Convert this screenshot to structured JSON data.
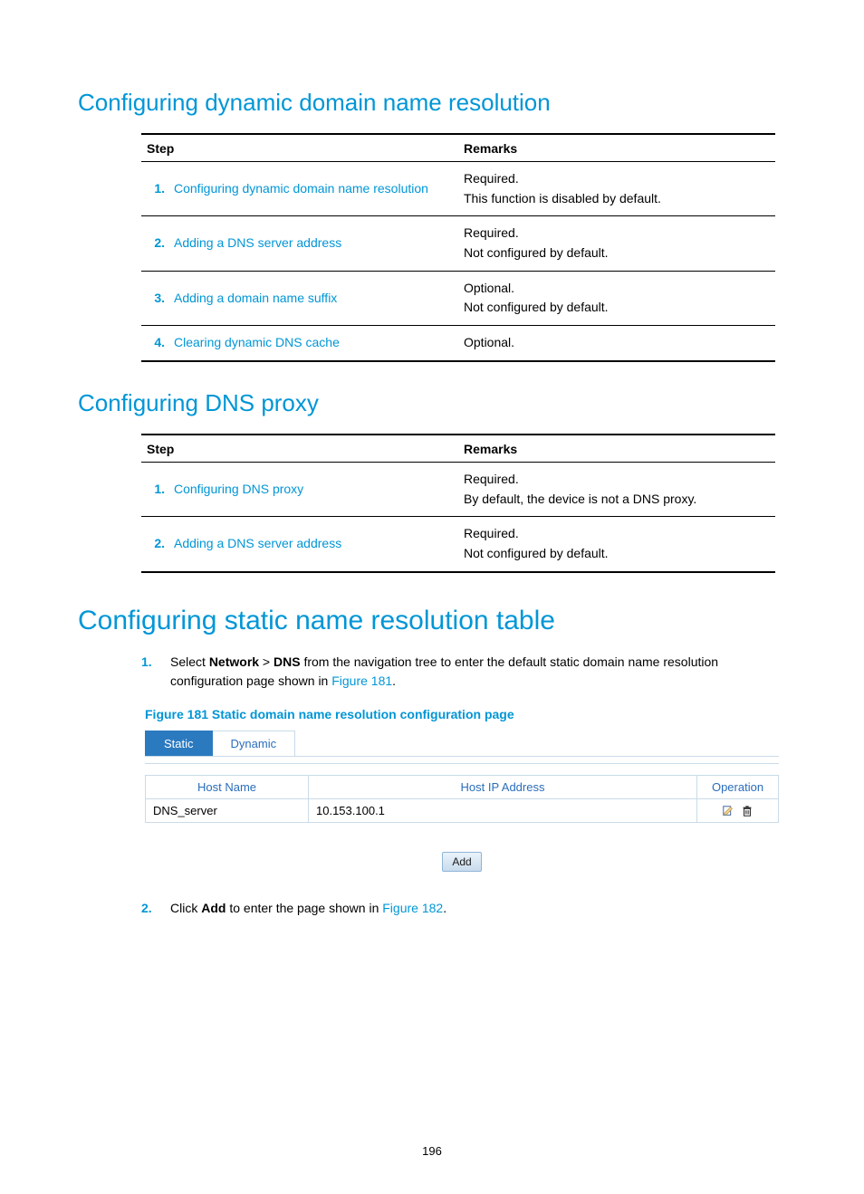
{
  "headings": {
    "h2_1": "Configuring dynamic domain name resolution",
    "h2_2": "Configuring DNS proxy",
    "h1_1": "Configuring static name resolution table"
  },
  "table_headers": {
    "step": "Step",
    "remarks": "Remarks"
  },
  "table1": [
    {
      "num": "1.",
      "step": "Configuring dynamic domain name resolution",
      "remarks": "Required.\nThis function is disabled by default."
    },
    {
      "num": "2.",
      "step": "Adding a DNS server address",
      "remarks": "Required.\nNot configured by default."
    },
    {
      "num": "3.",
      "step": "Adding a domain name suffix",
      "remarks": "Optional.\nNot configured by default."
    },
    {
      "num": "4.",
      "step": "Clearing dynamic DNS cache",
      "remarks": "Optional."
    }
  ],
  "table2": [
    {
      "num": "1.",
      "step": "Configuring DNS proxy",
      "remarks": "Required.\nBy default, the device is not a DNS proxy."
    },
    {
      "num": "2.",
      "step": "Adding a DNS server address",
      "remarks": "Required.\nNot configured by default."
    }
  ],
  "ol1": {
    "num": "1.",
    "pre": "Select ",
    "b1": "Network",
    "gt": " > ",
    "b2": "DNS",
    "post": " from the navigation tree to enter the default static domain name resolution configuration page shown in ",
    "link": "Figure 181",
    "tail": "."
  },
  "fig_caption": "Figure 181 Static domain name resolution configuration page",
  "tabs": {
    "static": "Static",
    "dynamic": "Dynamic"
  },
  "dnstable": {
    "headers": {
      "host": "Host Name",
      "ip": "Host IP Address",
      "op": "Operation"
    },
    "row": {
      "host": "DNS_server",
      "ip": "10.153.100.1"
    }
  },
  "add_button": "Add",
  "ol2": {
    "num": "2.",
    "pre": "Click ",
    "b1": "Add",
    "post": " to enter the page shown in ",
    "link": "Figure 182",
    "tail": "."
  },
  "page_number": "196"
}
